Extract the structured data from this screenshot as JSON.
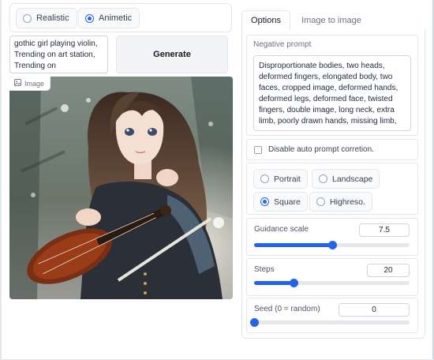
{
  "style_options": {
    "realistic_label": "Realistic",
    "animetic_label": "Animetic",
    "selected": "Animetic"
  },
  "prompt": {
    "value": "gothic girl playing violin, Trending on art station, Trending on"
  },
  "generate_label": "Generate",
  "image_panel": {
    "label": "Image",
    "icon": "image-icon"
  },
  "tabs": {
    "options_label": "Options",
    "image_to_image_label": "Image to image",
    "active": "Options"
  },
  "negative_prompt": {
    "label": "Negative prompt",
    "value": "Disproportionate bodies, two heads, deformed fingers, elongated body, two faces, cropped image, deformed hands, deformed legs, deformed face, twisted fingers, double image, long neck, extra limb, poorly drawn hands, missing limb,"
  },
  "auto_prompt": {
    "label": "Disable auto prompt corretion.",
    "checked": false
  },
  "resolution": {
    "portrait_label": "Portrait",
    "landscape_label": "Landscape",
    "square_label": "Square",
    "highreso_label": "Highreso.",
    "selected": "Square"
  },
  "guidance_scale": {
    "label": "Guidance scale",
    "value": "7.5",
    "fraction": 0.5
  },
  "steps": {
    "label": "Steps",
    "value": "20",
    "fraction": 0.255
  },
  "seed": {
    "label": "Seed (0 = random)",
    "value": "0",
    "fraction": 0.0
  },
  "colors": {
    "accent": "#2563eb"
  }
}
